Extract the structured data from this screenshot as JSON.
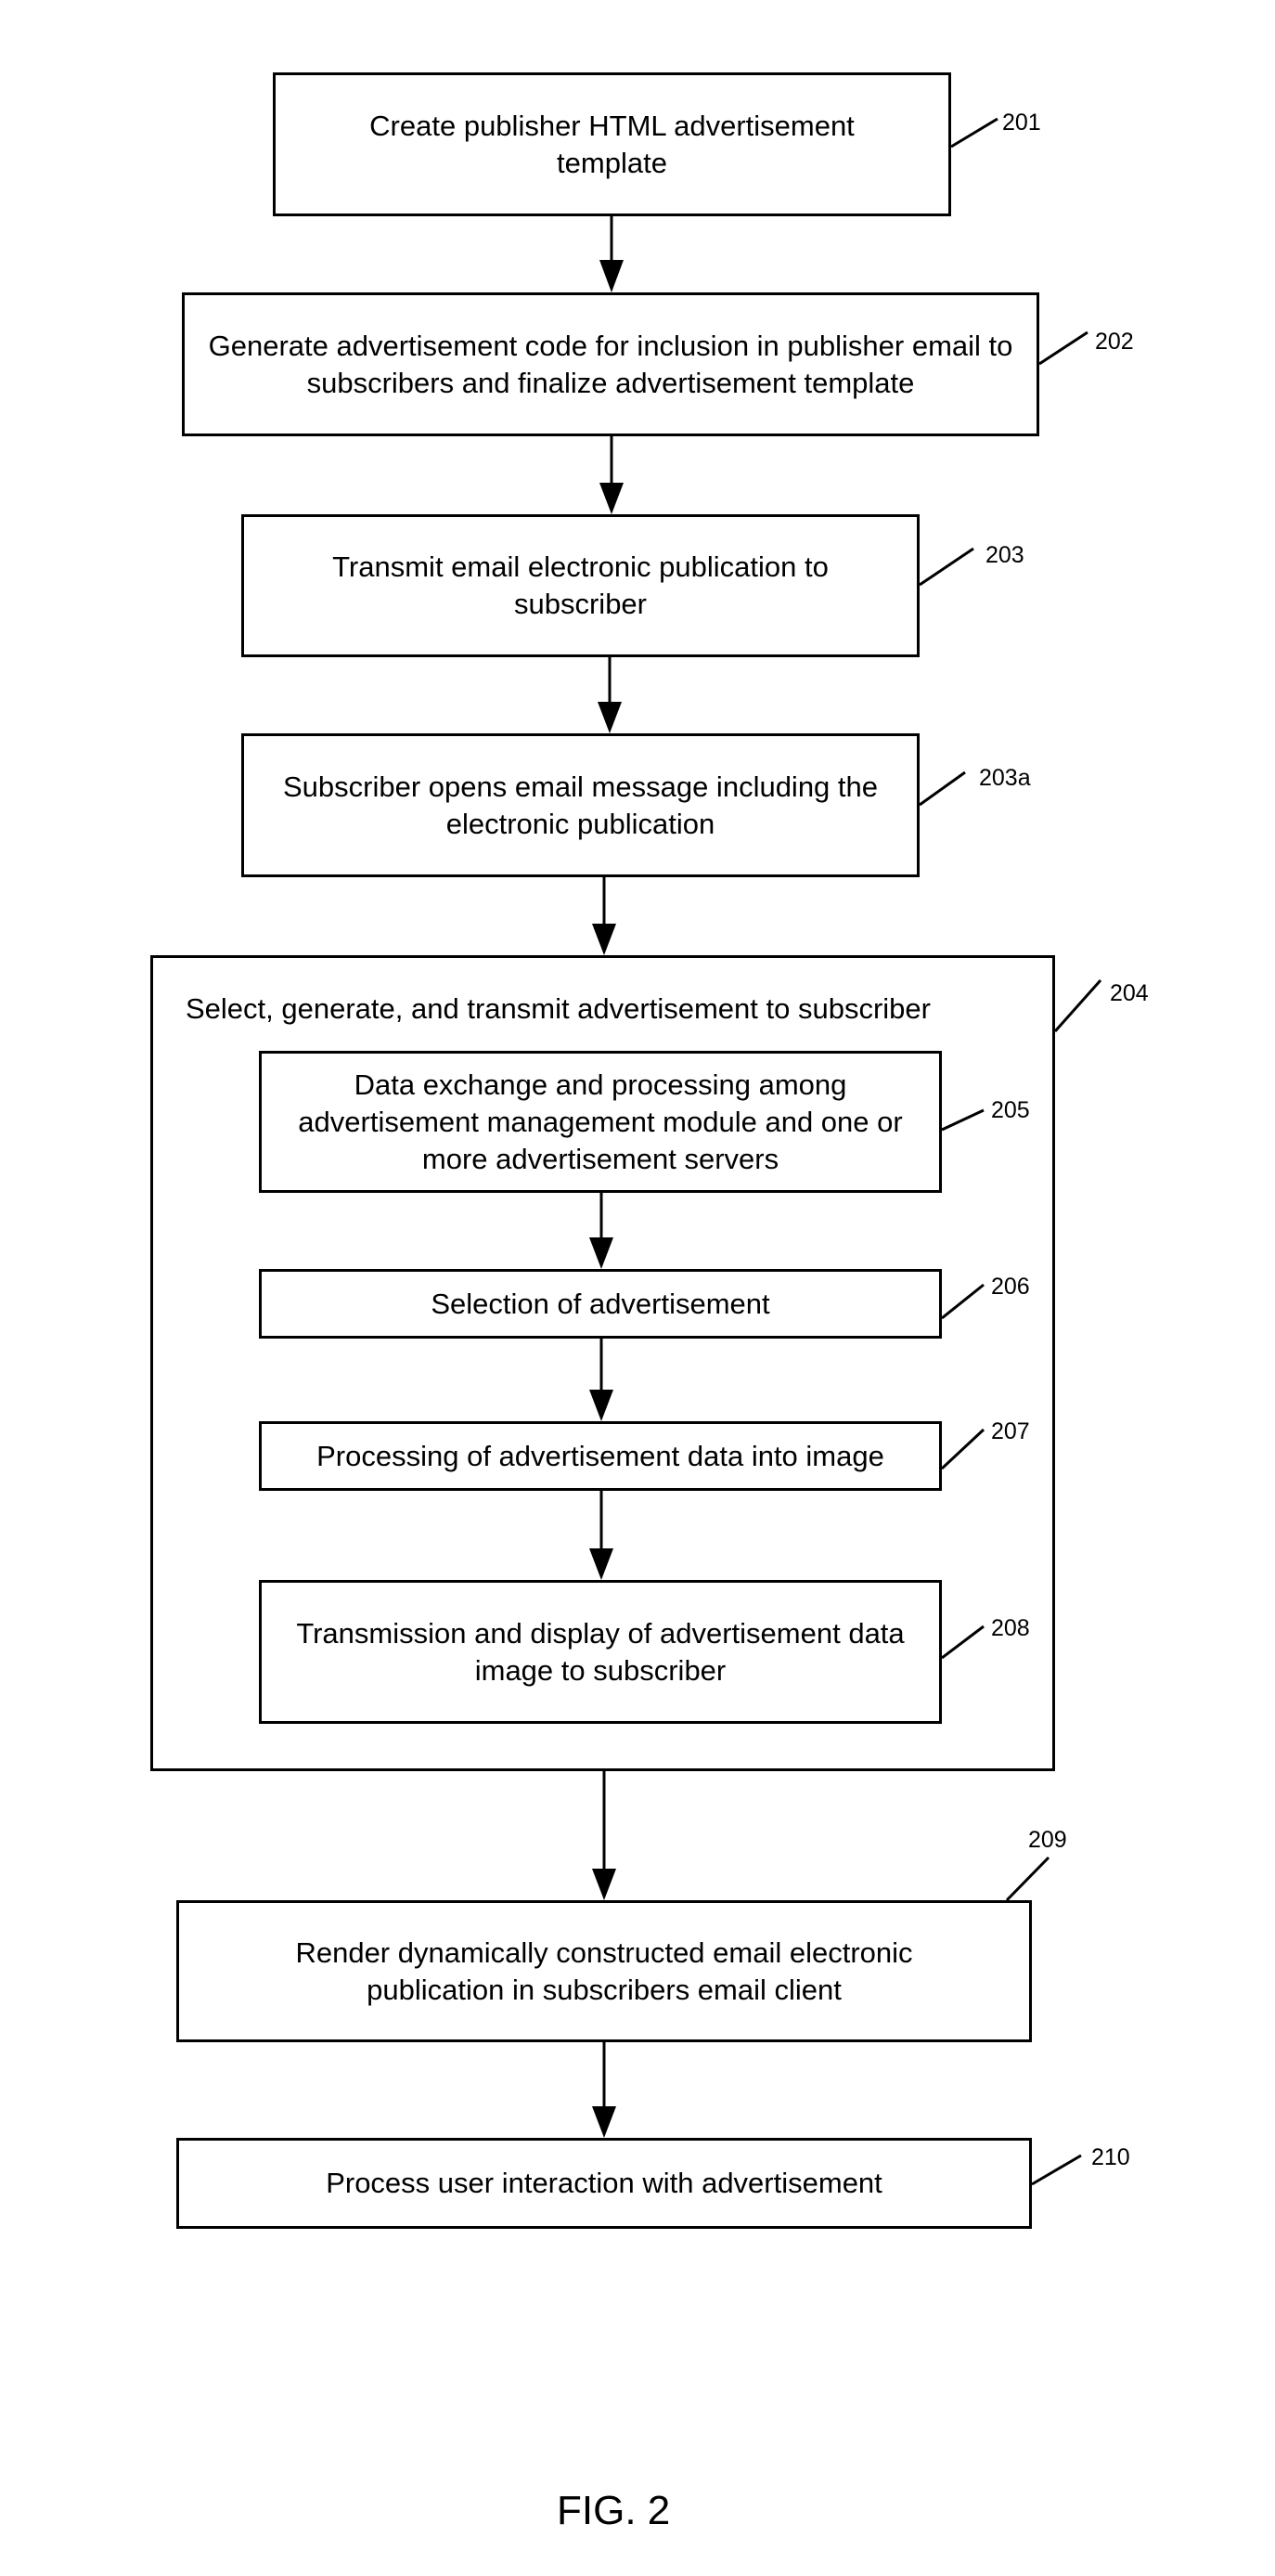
{
  "figure": {
    "caption": "FIG. 2",
    "steps": [
      {
        "ref": "201",
        "text": "Create publisher HTML advertisement template"
      },
      {
        "ref": "202",
        "text": "Generate advertisement code for inclusion in publisher email to subscribers and finalize advertisement template"
      },
      {
        "ref": "203",
        "text": "Transmit email electronic publication to subscriber"
      },
      {
        "ref": "203a",
        "text": "Subscriber opens email message including the electronic publication"
      },
      {
        "ref": "204",
        "text": "Select, generate, and transmit advertisement to subscriber"
      },
      {
        "ref": "205",
        "text": "Data exchange and processing among advertisement management module and one or more advertisement servers"
      },
      {
        "ref": "206",
        "text": "Selection of advertisement"
      },
      {
        "ref": "207",
        "text": "Processing of advertisement data into image"
      },
      {
        "ref": "208",
        "text": "Transmission and display of advertisement data image to subscriber"
      },
      {
        "ref": "209",
        "text": "Render dynamically constructed email electronic publication in subscribers email client"
      },
      {
        "ref": "210",
        "text": "Process user interaction with advertisement"
      }
    ]
  }
}
